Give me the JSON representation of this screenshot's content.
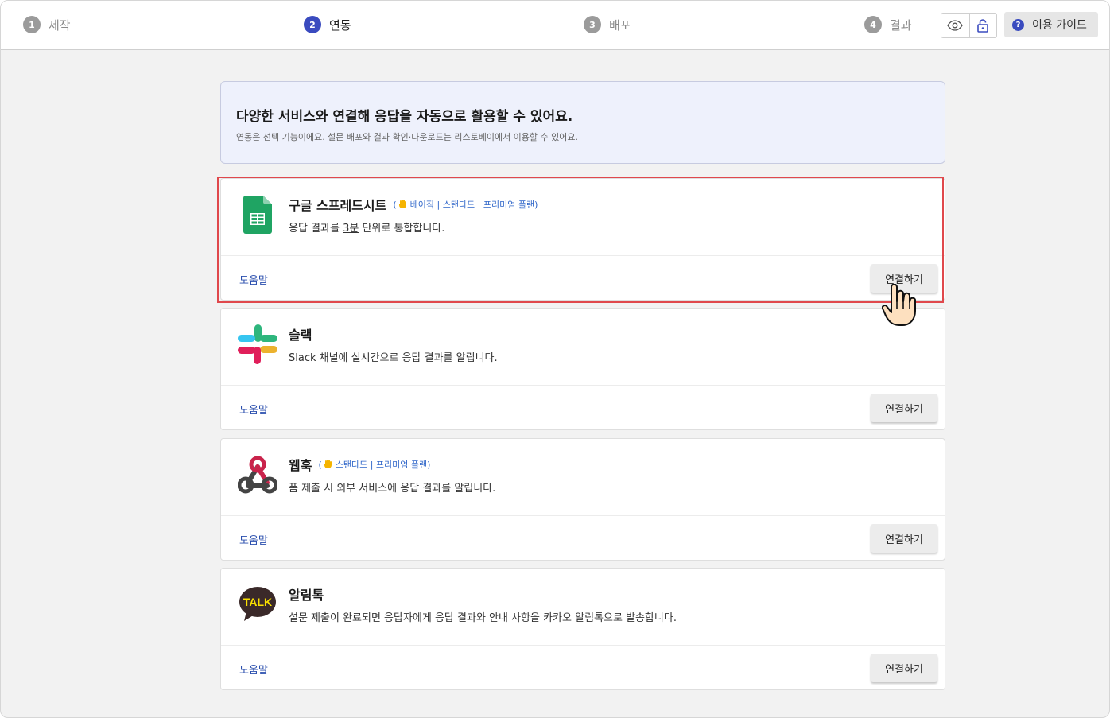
{
  "steps": [
    {
      "num": "1",
      "label": "제작"
    },
    {
      "num": "2",
      "label": "연동"
    },
    {
      "num": "3",
      "label": "배포"
    },
    {
      "num": "4",
      "label": "결과"
    }
  ],
  "toolbar": {
    "preview_icon": "eye-icon",
    "lock_icon": "lock-icon",
    "guide_icon": "question-icon",
    "guide_label": "이용 가이드"
  },
  "banner": {
    "title": "다양한 서비스와 연결해 응답을 자동으로 활용할 수 있어요.",
    "subtitle": "연동은 선택 기능이에요. 설문 배포와 결과 확인·다운로드는 리스토베이에서 이용할 수 있어요."
  },
  "integrations": [
    {
      "name": "구글 스프레드시트",
      "icon": "google-sheets-icon",
      "plan_open": "(",
      "plan": "베이직 | 스탠다드 | 프리미엄 플랜",
      "plan_close": ")",
      "desc_before": "응답 결과를 ",
      "desc_underline": "3분",
      "desc_after": " 단위로 통합합니다.",
      "help": "도움말",
      "button": "연결하기"
    },
    {
      "name": "슬랙",
      "icon": "slack-icon",
      "desc": "Slack 채널에 실시간으로 응답 결과를 알립니다.",
      "help": "도움말",
      "button": "연결하기"
    },
    {
      "name": "웹훅",
      "icon": "webhook-icon",
      "plan_open": "(",
      "plan": "스탠다드 | 프리미엄 플랜",
      "plan_close": ")",
      "desc": "폼 제출 시 외부 서비스에 응답 결과를 알립니다.",
      "help": "도움말",
      "button": "연결하기"
    },
    {
      "name": "알림톡",
      "icon": "kakao-talk-icon",
      "icon_text": "TALK",
      "desc": "설문 제출이 완료되면 응답자에게 응답 결과와 안내 사항을 카카오 알림톡으로 발송합니다.",
      "help": "도움말",
      "button": "연결하기"
    }
  ],
  "colors": {
    "accent": "#3a4bbf",
    "link": "#2b4fae",
    "highlight": "#e0484c",
    "sheets_green": "#1fa463"
  }
}
